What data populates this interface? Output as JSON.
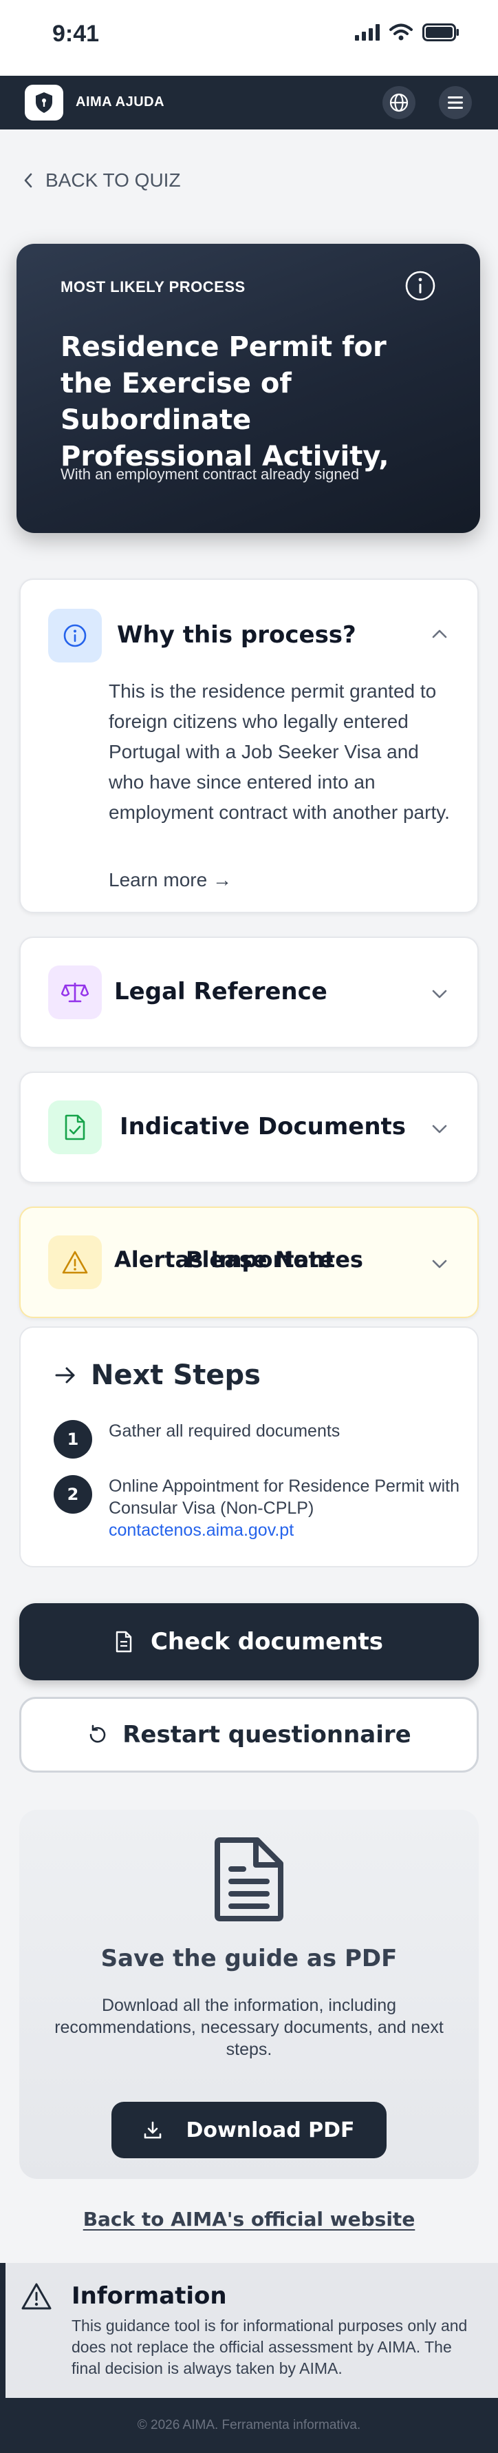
{
  "status_bar": {
    "time": "9:41"
  },
  "header": {
    "app_name": "AIMA AJUDA"
  },
  "back_link": "BACK TO QUIZ",
  "result": {
    "eyebrow": "MOST LIKELY PROCESS",
    "title": "Residence Permit for the Exercise of Subordinate Professional Activity,",
    "subtitle": "With an employment contract already signed"
  },
  "why": {
    "title": "Why this process?",
    "body": "This is the residence permit granted to foreign citizens who legally entered Portugal with a Job Seeker Visa and who have since entered into an employment contract with another party.",
    "learn_more": "Learn more →"
  },
  "legal": {
    "title": "Legal Reference"
  },
  "documents": {
    "title": "Indicative Documents"
  },
  "alerts": {
    "title": "Alertas Importantes",
    "overlay_title": "Please Note"
  },
  "next_steps": {
    "title": "Next Steps",
    "steps": [
      {
        "number": "1",
        "text": "Gather all required documents"
      },
      {
        "number": "2",
        "text": "Online Appointment for Residence Permit with Consular Visa (Non-CPLP)",
        "link": "contactenos.aima.gov.pt"
      }
    ]
  },
  "actions": {
    "check_documents": "Check documents",
    "restart": "Restart questionnaire"
  },
  "pdf": {
    "title": "Save the guide as PDF",
    "description": "Download all the information, including recommendations, necessary documents, and next steps.",
    "button": "Download PDF"
  },
  "official_link": "Back to AIMA's official website",
  "info": {
    "title": "Information",
    "text": "This guidance tool is for informational purposes only and does not replace the official assessment by AIMA. The final decision is always taken by AIMA."
  },
  "footer": "© 2026 AIMA. Ferramenta informativa.",
  "colors": {
    "primary": "#1f2937",
    "link": "#2563eb",
    "info_icon_bg": "#dbeafe",
    "legal_icon_bg": "#f3e8ff",
    "docs_icon_bg": "#dcfce7",
    "alert_icon_bg": "#fef3c7"
  }
}
